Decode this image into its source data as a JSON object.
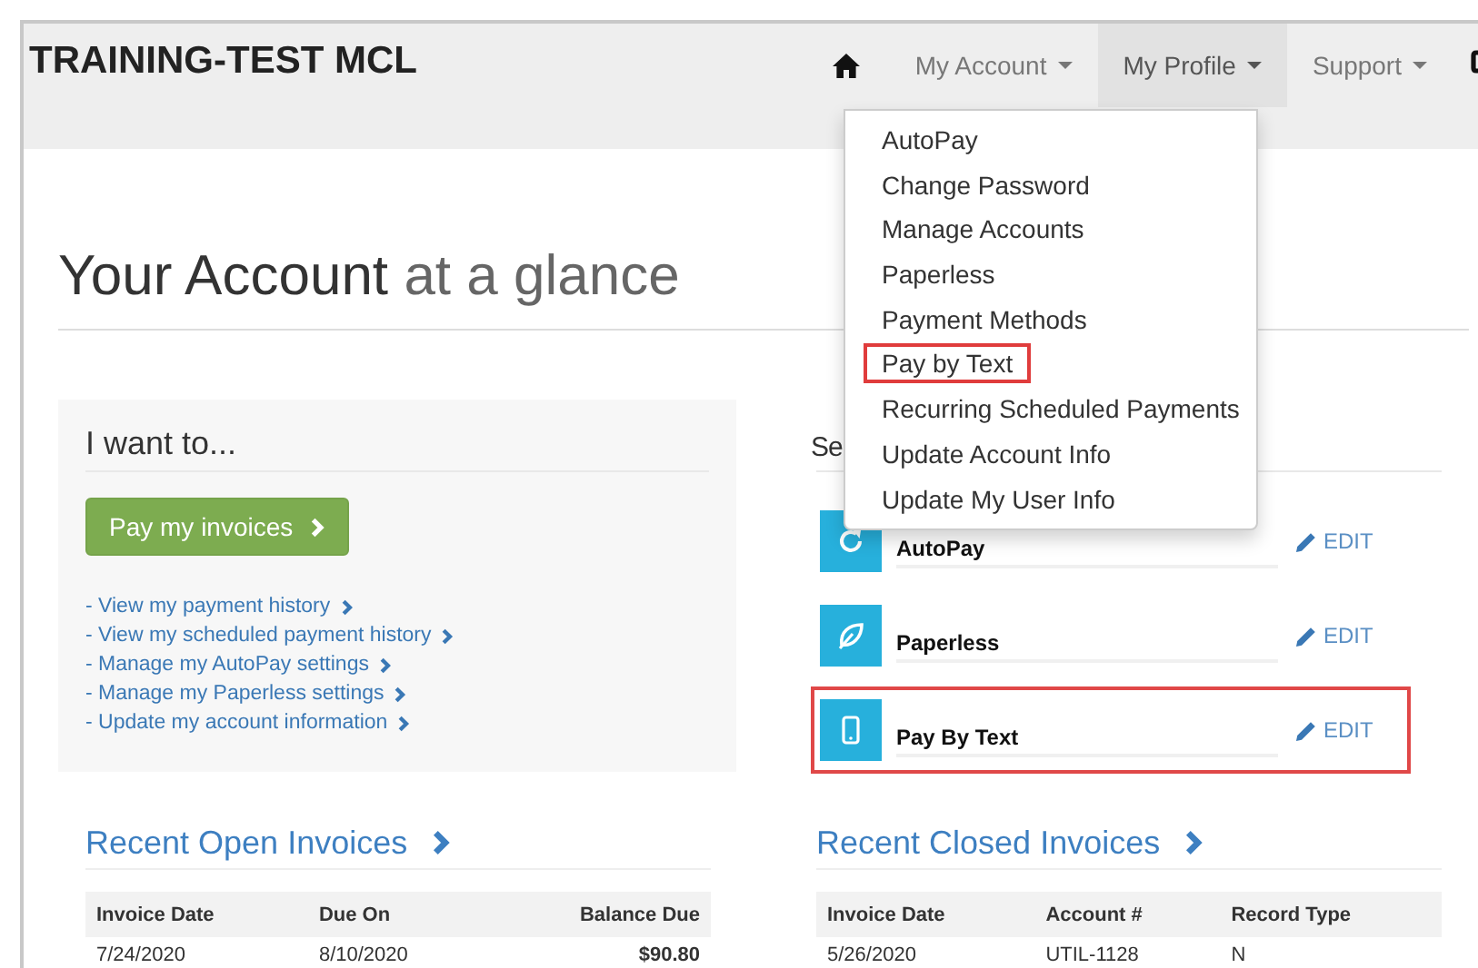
{
  "brand": "TRAINING-TEST MCL",
  "nav": [
    {
      "kind": "home",
      "selected": false
    },
    {
      "kind": "menu",
      "label": "My Account",
      "selected": false
    },
    {
      "kind": "menu",
      "label": "My Profile",
      "selected": true
    },
    {
      "kind": "menu",
      "label": "Support",
      "selected": false
    }
  ],
  "dropdown": [
    {
      "label": "AutoPay",
      "highlighted": false
    },
    {
      "label": "Change Password",
      "highlighted": false
    },
    {
      "label": "Manage Accounts",
      "highlighted": false
    },
    {
      "label": "Paperless",
      "highlighted": false
    },
    {
      "label": "Payment Methods",
      "highlighted": false
    },
    {
      "label": "Pay by Text",
      "highlighted": true
    },
    {
      "label": "Recurring Scheduled Payments",
      "highlighted": false
    },
    {
      "label": "Update Account Info",
      "highlighted": false
    },
    {
      "label": "Update My User Info",
      "highlighted": false
    }
  ],
  "heading": {
    "main": "Your Account",
    "accent": "at a glance"
  },
  "actions": {
    "title": "I want to...",
    "button": "Pay my invoices",
    "links": [
      "- View my payment history",
      "- View my scheduled payment history",
      "- Manage my AutoPay settings",
      "- Manage my Paperless settings",
      "- Update my account information"
    ]
  },
  "settings": {
    "title": "Se",
    "items": [
      {
        "kind": "autopay",
        "label": "AutoPay",
        "action": "EDIT",
        "highlighted": false
      },
      {
        "kind": "paperless",
        "label": "Paperless",
        "action": "EDIT",
        "highlighted": false
      },
      {
        "kind": "text",
        "label": "Pay By Text",
        "action": "EDIT",
        "highlighted": true
      }
    ]
  },
  "tables": [
    {
      "title": "Recent Open Invoices",
      "columns": [
        {
          "label": "Invoice Date",
          "kind": "text"
        },
        {
          "label": "Due On",
          "kind": "text"
        },
        {
          "label": "Balance Due",
          "kind": "amount"
        }
      ],
      "rows": [
        [
          "7/24/2020",
          "8/10/2020",
          "$90.80"
        ]
      ]
    },
    {
      "title": "Recent Closed Invoices",
      "columns": [
        {
          "label": "Invoice Date",
          "kind": "text"
        },
        {
          "label": "Account #",
          "kind": "text"
        },
        {
          "label": "Record Type",
          "kind": "text"
        }
      ],
      "rows": [
        [
          "5/26/2020",
          "UTIL-1128",
          "N"
        ]
      ]
    }
  ]
}
